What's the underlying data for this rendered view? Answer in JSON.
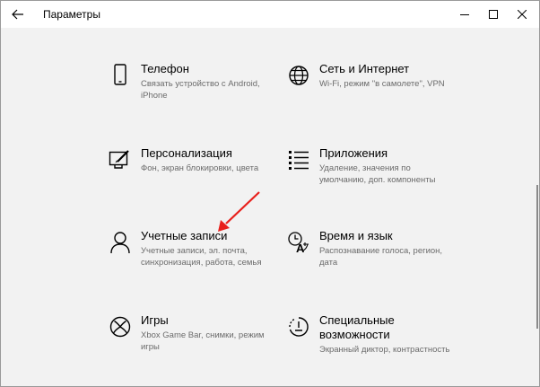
{
  "window": {
    "title": "Параметры",
    "back_icon": "arrow-left-icon",
    "minimize_icon": "minimize-icon",
    "maximize_icon": "maximize-icon",
    "close_icon": "close-icon"
  },
  "tiles": [
    {
      "icon": "phone-icon",
      "name": "Телефон",
      "desc": "Связать устройство с Android, iPhone"
    },
    {
      "icon": "globe-icon",
      "name": "Сеть и Интернет",
      "desc": "Wi-Fi, режим \"в самолете\", VPN"
    },
    {
      "icon": "personalization-icon",
      "name": "Персонализация",
      "desc": "Фон, экран блокировки, цвета"
    },
    {
      "icon": "apps-list-icon",
      "name": "Приложения",
      "desc": "Удаление, значения по умолчанию, доп. компоненты"
    },
    {
      "icon": "person-icon",
      "name": "Учетные записи",
      "desc": "Учетные записи, эл. почта, синхронизация, работа, семья"
    },
    {
      "icon": "time-language-icon",
      "name": "Время и язык",
      "desc": "Распознавание голоса, регион, дата"
    },
    {
      "icon": "xbox-icon",
      "name": "Игры",
      "desc": "Xbox Game Bar, снимки, режим игры"
    },
    {
      "icon": "accessibility-icon",
      "name": "Специальные возможности",
      "desc": "Экранный диктор, контрастность"
    }
  ],
  "annotation": {
    "arrow_color": "#e8201c"
  }
}
